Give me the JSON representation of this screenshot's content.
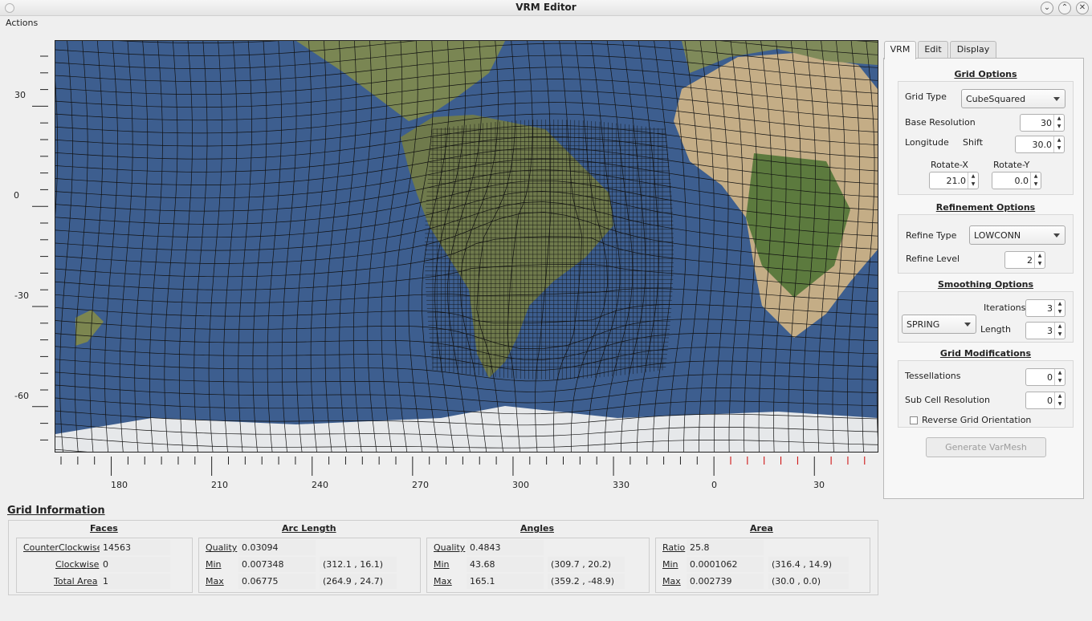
{
  "window": {
    "title": "VRM Editor",
    "minimize_icon": "chevron-down-icon",
    "maximize_icon": "chevron-up-icon",
    "close_icon": "close-icon"
  },
  "menu": {
    "actions": "Actions"
  },
  "axes": {
    "y_labels": [
      "30",
      "0",
      "-30",
      "-60"
    ],
    "x_labels": [
      "180",
      "210",
      "240",
      "270",
      "300",
      "330",
      "0",
      "30"
    ]
  },
  "tabs": [
    {
      "label": "VRM",
      "active": true
    },
    {
      "label": "Edit",
      "active": false
    },
    {
      "label": "Display",
      "active": false
    }
  ],
  "grid_options": {
    "title": "Grid Options",
    "grid_type_label": "Grid Type",
    "grid_type_value": "CubeSquared",
    "base_resolution_label": "Base Resolution",
    "base_resolution_value": "30",
    "longitude_label": "Longitude",
    "shift_label": "Shift",
    "longitude_shift_value": "30.0",
    "rotate_x_label": "Rotate-X",
    "rotate_x_value": "21.0",
    "rotate_y_label": "Rotate-Y",
    "rotate_y_value": "0.0"
  },
  "refinement_options": {
    "title": "Refinement Options",
    "refine_type_label": "Refine Type",
    "refine_type_value": "LOWCONN",
    "refine_level_label": "Refine Level",
    "refine_level_value": "2"
  },
  "smoothing_options": {
    "title": "Smoothing Options",
    "method_value": "SPRING",
    "iterations_label": "Iterations",
    "iterations_value": "3",
    "length_label": "Length",
    "length_value": "3"
  },
  "grid_modifications": {
    "title": "Grid Modifications",
    "tessellations_label": "Tessellations",
    "tessellations_value": "0",
    "sub_cell_label": "Sub Cell Resolution",
    "sub_cell_value": "0",
    "reverse_label": "Reverse Grid Orientation",
    "reverse_checked": false
  },
  "generate_button": "Generate VarMesh",
  "grid_information": {
    "title": "Grid Information",
    "faces": {
      "title": "Faces",
      "ccw_label": "CounterClockwise",
      "ccw_value": "14563",
      "cw_label": "Clockwise",
      "cw_value": "0",
      "total_label": "Total Area",
      "total_value": "1"
    },
    "arc_length": {
      "title": "Arc Length",
      "quality_label": "Quality",
      "quality_value": "0.03094",
      "min_label": "Min",
      "min_value": "0.007348",
      "min_loc": "(312.1 , 16.1)",
      "max_label": "Max",
      "max_value": "0.06775",
      "max_loc": "(264.9 , 24.7)"
    },
    "angles": {
      "title": "Angles",
      "quality_label": "Quality",
      "quality_value": "0.4843",
      "min_label": "Min",
      "min_value": "43.68",
      "min_loc": "(309.7 , 20.2)",
      "max_label": "Max",
      "max_value": "165.1",
      "max_loc": "(359.2 , -48.9)"
    },
    "area": {
      "title": "Area",
      "ratio_label": "Ratio",
      "ratio_value": "25.8",
      "min_label": "Min",
      "min_value": "0.0001062",
      "min_loc": "(316.4 , 14.9)",
      "max_label": "Max",
      "max_value": "0.002739",
      "max_loc": "(30.0 , 0.0)"
    }
  },
  "colors": {
    "ocean": "#3c5d8e",
    "land": "#7d8a55",
    "desert": "#c9b08a",
    "ice": "#e8eaec",
    "grid": "#111111",
    "red_tick": "#cc0000"
  }
}
